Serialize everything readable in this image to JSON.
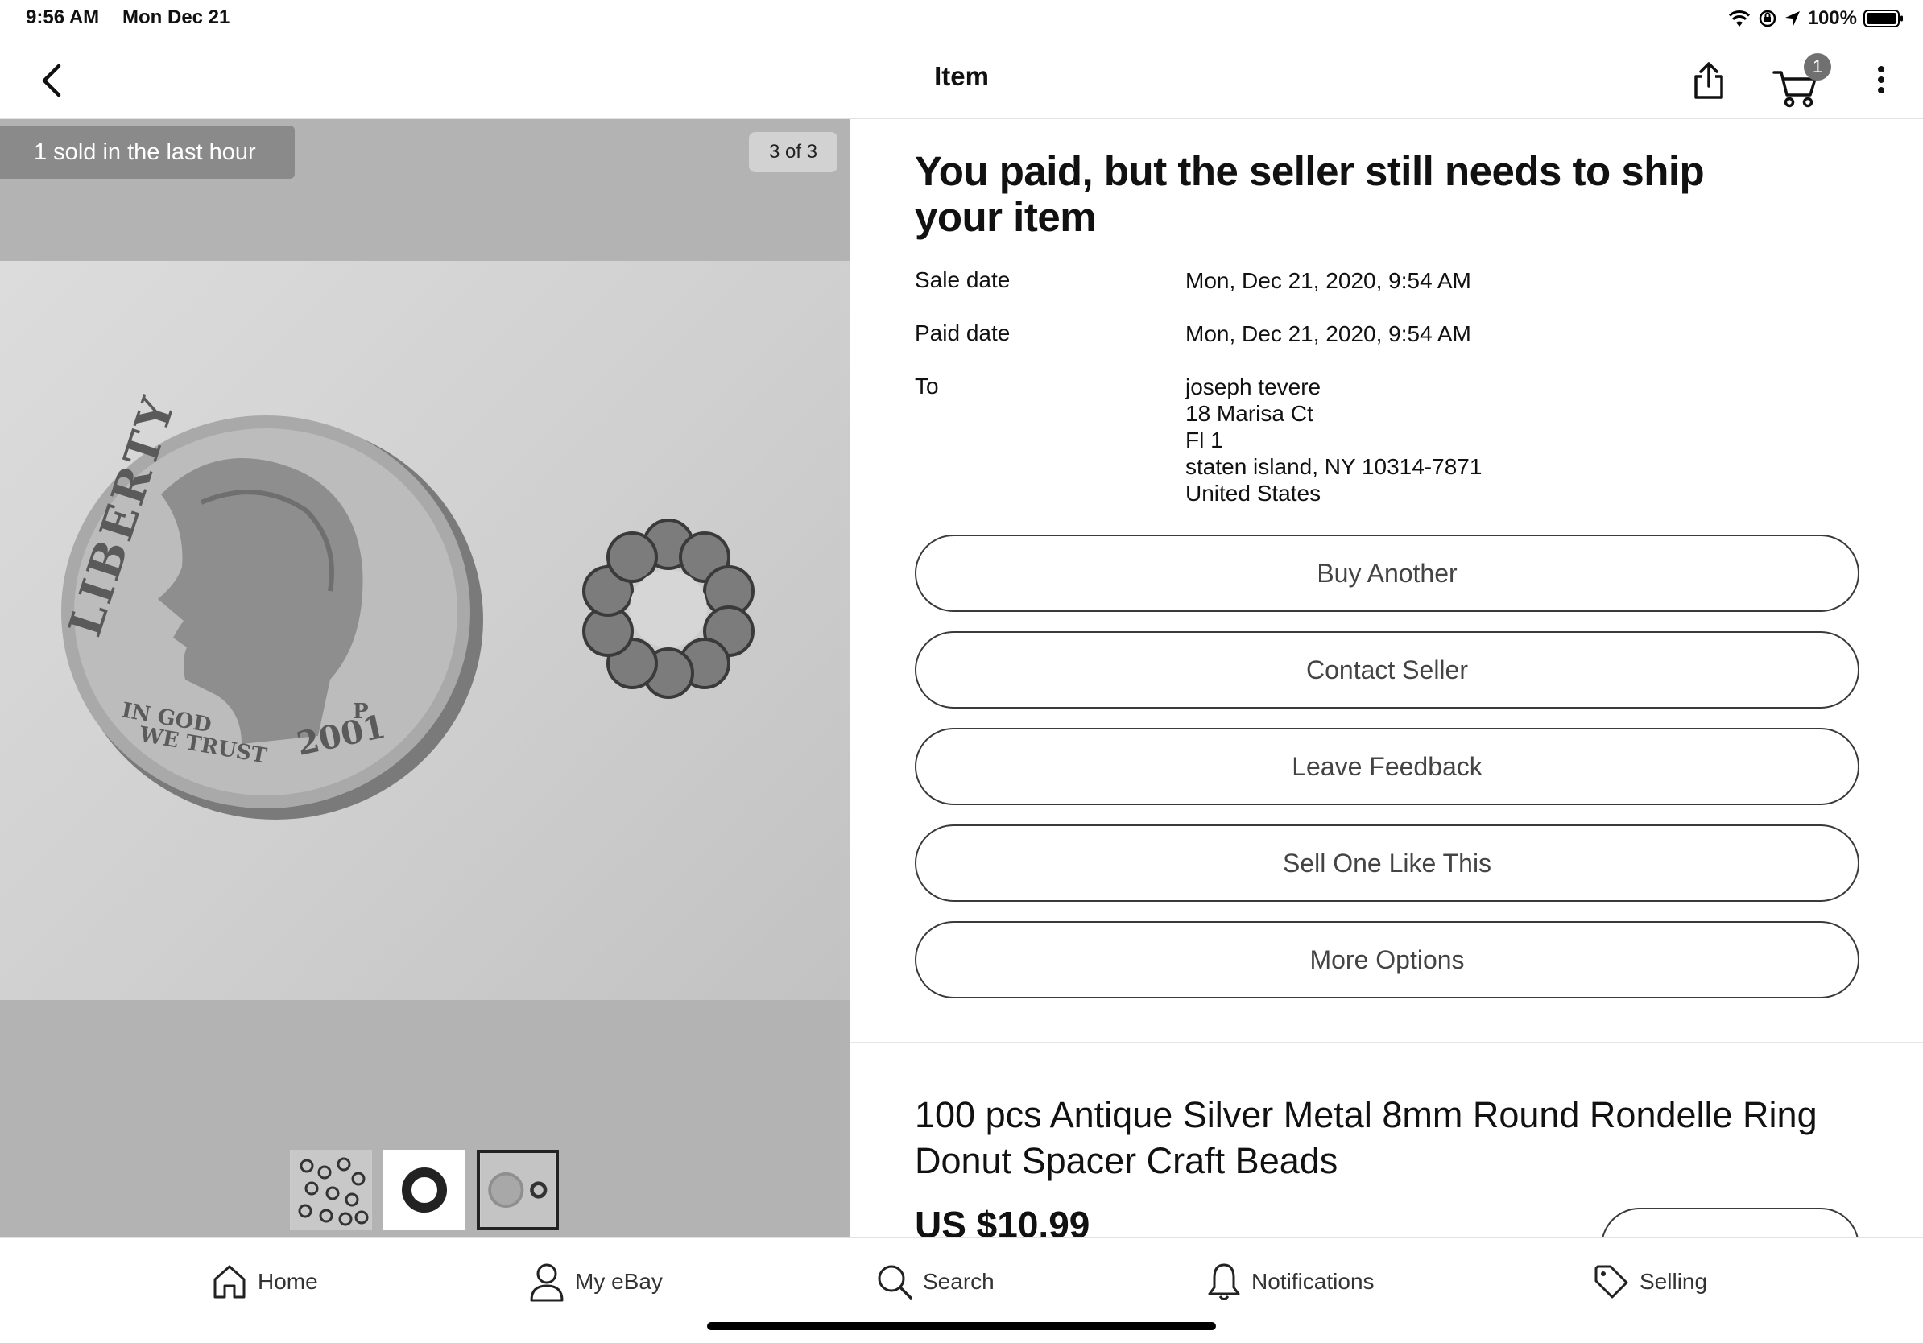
{
  "status_bar": {
    "time": "9:56 AM",
    "date": "Mon Dec 21",
    "battery": "100%"
  },
  "nav": {
    "title": "Item",
    "cart_count": "1"
  },
  "gallery": {
    "sold_badge": "1 sold in the last hour",
    "counter": "3 of 3",
    "coin_text_top": "LIBERTY",
    "coin_text_motto_1": "IN GOD",
    "coin_text_motto_2": "WE TRUST",
    "coin_year": "2001",
    "coin_mint": "P",
    "selected_thumbnail": 3
  },
  "order": {
    "headline": "You paid, but the seller still needs to ship your item",
    "sale_date_label": "Sale date",
    "sale_date": "Mon, Dec 21, 2020, 9:54 AM",
    "paid_date_label": "Paid date",
    "paid_date": "Mon, Dec 21, 2020, 9:54 AM",
    "to_label": "To",
    "address": {
      "name": "joseph tevere",
      "line1": "18 Marisa Ct",
      "line2": "Fl 1",
      "city_state_zip": "staten island, NY 10314-7871",
      "country": "United States"
    }
  },
  "actions": {
    "buy_another": "Buy Another",
    "contact_seller": "Contact Seller",
    "leave_feedback": "Leave Feedback",
    "sell_one_like_this": "Sell One Like This",
    "more_options": "More Options"
  },
  "item": {
    "title": "100 pcs Antique Silver Metal 8mm Round Rondelle Ring Donut Spacer Craft Beads",
    "price": "US $10.99"
  },
  "tabs": {
    "home": "Home",
    "my_ebay": "My eBay",
    "search": "Search",
    "notifications": "Notifications",
    "selling": "Selling"
  },
  "icons": [
    "back-icon",
    "share-icon",
    "cart-icon",
    "more-vertical-icon",
    "home-icon",
    "person-icon",
    "search-icon",
    "bell-icon",
    "tag-icon",
    "wifi-icon",
    "location-icon",
    "battery-icon"
  ]
}
